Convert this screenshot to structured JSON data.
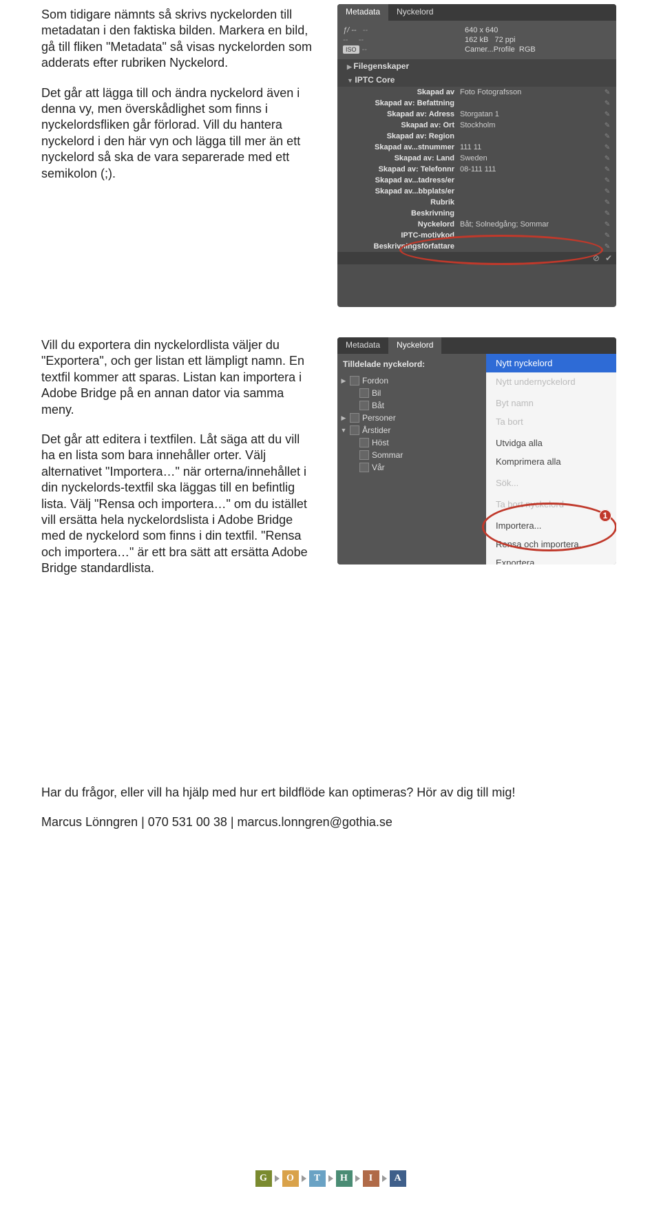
{
  "text": {
    "p1": "Som tidigare nämnts så skrivs nyckelorden till metadatan i den faktiska bilden. Markera en bild, gå till fliken \"Metadata\" så visas nyckelorden som adderats efter rubriken Nyckelord.",
    "p2": "Det går att lägga till och ändra nyckelord även i denna vy, men överskådlighet som finns i nyckelordsfliken går förlorad. Vill du hantera nyckelord i den här vyn och lägga till mer än ett nyckelord så ska de vara separerade med ett semikolon (;).",
    "p3": "Vill du exportera din nyckelordlista väljer du \"Exportera\", och ger listan ett lämpligt namn. En textfil kommer att sparas. Listan kan importera i Adobe Bridge på en annan dator via samma meny.",
    "p4": "Det går att editera i textfilen. Låt säga att du vill ha en lista som bara innehåller orter. Välj alternativet \"Importera…\" när orterna/innehållet i din nyckelords-textfil ska läggas till en befintlig lista. Välj \"Rensa och importera…\" om du istället vill ersätta hela nyckelordslista i Adobe Bridge med de nyckelord som finns i din textfil. \"Rensa och importera…\" är ett bra sätt att ersätta Adobe Bridge standardlista.",
    "footer1": "Har du frågor, eller vill ha hjälp med hur ert bildflöde kan optimeras? Hör av dig till mig!",
    "footer2": "Marcus Lönngren | 070 531 00 38 | marcus.lonngren@gothia.se"
  },
  "panel1": {
    "tabs": {
      "metadata": "Metadata",
      "keywords": "Nyckelord"
    },
    "cam": {
      "f": "ƒ/ --",
      "dash1": "--",
      "dash2": "--",
      "dash3": "--",
      "iso_badge": "ISO",
      "iso": "--",
      "dim": "640 x 640",
      "size": "162 kB",
      "ppi": "72 ppi",
      "profile": "Camer...Profile",
      "rgb": "RGB"
    },
    "sec_file": "Filegenskaper",
    "sec_iptc": "IPTC Core",
    "rows": [
      {
        "l": "Skapad av",
        "v": "Foto Fotografsson"
      },
      {
        "l": "Skapad av: Befattning",
        "v": ""
      },
      {
        "l": "Skapad av: Adress",
        "v": "Storgatan 1"
      },
      {
        "l": "Skapad av: Ort",
        "v": "Stockholm"
      },
      {
        "l": "Skapad av: Region",
        "v": ""
      },
      {
        "l": "Skapad av...stnummer",
        "v": "111 11"
      },
      {
        "l": "Skapad av: Land",
        "v": "Sweden"
      },
      {
        "l": "Skapad av: Telefonnr",
        "v": "08-111 111"
      },
      {
        "l": "Skapad av...tadress/er",
        "v": ""
      },
      {
        "l": "Skapad av...bbplats/er",
        "v": ""
      },
      {
        "l": "Rubrik",
        "v": ""
      },
      {
        "l": "Beskrivning",
        "v": ""
      },
      {
        "l": "Nyckelord",
        "v": "Båt; Solnedgång; Sommar"
      },
      {
        "l": "IPTC-motivkod",
        "v": ""
      },
      {
        "l": "Beskrivningsförfattare",
        "v": ""
      }
    ]
  },
  "panel2": {
    "tabs": {
      "metadata": "Metadata",
      "keywords": "Nyckelord"
    },
    "left_hdr": "Tilldelade nyckelord:",
    "left_items": [
      {
        "tri": "▶",
        "label": "Fordon",
        "child": false
      },
      {
        "tri": "",
        "label": "Bil",
        "child": true
      },
      {
        "tri": "",
        "label": "Båt",
        "child": true
      },
      {
        "tri": "▶",
        "label": "Personer",
        "child": false
      },
      {
        "tri": "▼",
        "label": "Årstider",
        "child": false
      },
      {
        "tri": "",
        "label": "Höst",
        "child": true
      },
      {
        "tri": "",
        "label": "Sommar",
        "child": true
      },
      {
        "tri": "",
        "label": "Vår",
        "child": true
      }
    ],
    "menu": [
      {
        "t": "Nytt nyckelord",
        "sel": true
      },
      {
        "t": "Nytt undernyckelord",
        "dim": true
      },
      {
        "sep": true
      },
      {
        "t": "Byt namn",
        "dim": true
      },
      {
        "t": "Ta bort",
        "dim": true
      },
      {
        "sep": true
      },
      {
        "t": "Utvidga alla"
      },
      {
        "t": "Komprimera alla"
      },
      {
        "sep": true
      },
      {
        "t": "Sök...",
        "dim": true
      },
      {
        "sep": true
      },
      {
        "t": "Ta bort nyckelord",
        "dim": true
      },
      {
        "sep": true
      },
      {
        "t": "Importera..."
      },
      {
        "t": "Rensa och importera..."
      },
      {
        "t": "Exportera..."
      }
    ],
    "badge": "1"
  },
  "logo": {
    "letters": [
      "G",
      "O",
      "T",
      "H",
      "I",
      "A"
    ],
    "colors": [
      "#7a8a2f",
      "#d9a24a",
      "#6aa2c4",
      "#4a8c74",
      "#b06a48",
      "#3f5f8a"
    ]
  }
}
